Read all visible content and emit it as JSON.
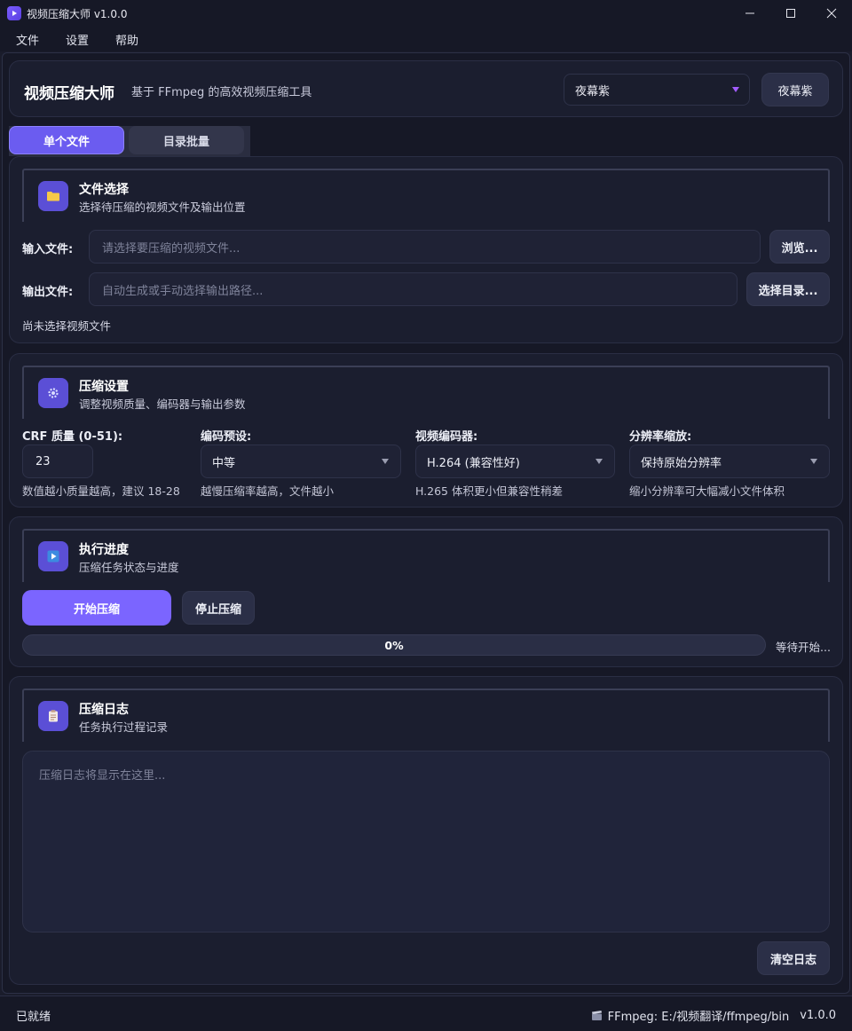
{
  "window": {
    "title": "视频压缩大师 v1.0.0"
  },
  "menu": [
    "文件",
    "设置",
    "帮助"
  ],
  "header": {
    "title": "视频压缩大师",
    "subtitle": "基于 FFmpeg 的高效视频压缩工具",
    "theme_value": "夜幕紫",
    "theme_button": "夜幕紫"
  },
  "tabs": [
    "单个文件",
    "目录批量"
  ],
  "file_section": {
    "title": "文件选择",
    "subtitle": "选择待压缩的视频文件及输出位置",
    "input_label": "输入文件:",
    "input_placeholder": "请选择要压缩的视频文件...",
    "browse_button": "浏览...",
    "output_label": "输出文件:",
    "output_placeholder": "自动生成或手动选择输出路径...",
    "choose_dir_button": "选择目录...",
    "status": "尚未选择视频文件"
  },
  "settings_section": {
    "title": "压缩设置",
    "subtitle": "调整视频质量、编码器与输出参数",
    "crf_label": "CRF 质量 (0-51):",
    "crf_value": "23",
    "crf_hint": "数值越小质量越高，建议 18-28",
    "preset_label": "编码预设:",
    "preset_value": "中等",
    "preset_hint": "越慢压缩率越高，文件越小",
    "codec_label": "视频编码器:",
    "codec_value": "H.264 (兼容性好)",
    "codec_hint": "H.265 体积更小但兼容性稍差",
    "scale_label": "分辨率缩放:",
    "scale_value": "保持原始分辨率",
    "scale_hint": "缩小分辨率可大幅减小文件体积"
  },
  "progress_section": {
    "title": "执行进度",
    "subtitle": "压缩任务状态与进度",
    "start_button": "开始压缩",
    "stop_button": "停止压缩",
    "progress": 0,
    "progress_text": "0%",
    "status": "等待开始..."
  },
  "log_section": {
    "title": "压缩日志",
    "subtitle": "任务执行过程记录",
    "placeholder": "压缩日志将显示在这里...",
    "clear_button": "清空日志"
  },
  "statusbar": {
    "left": "已就绪",
    "ffmpeg": "FFmpeg: E:/视频翻译/ffmpeg/bin",
    "version": "v1.0.0"
  },
  "colors": {
    "accent": "#7b65ff",
    "background": "#161826",
    "panel": "#1b1e2f"
  }
}
